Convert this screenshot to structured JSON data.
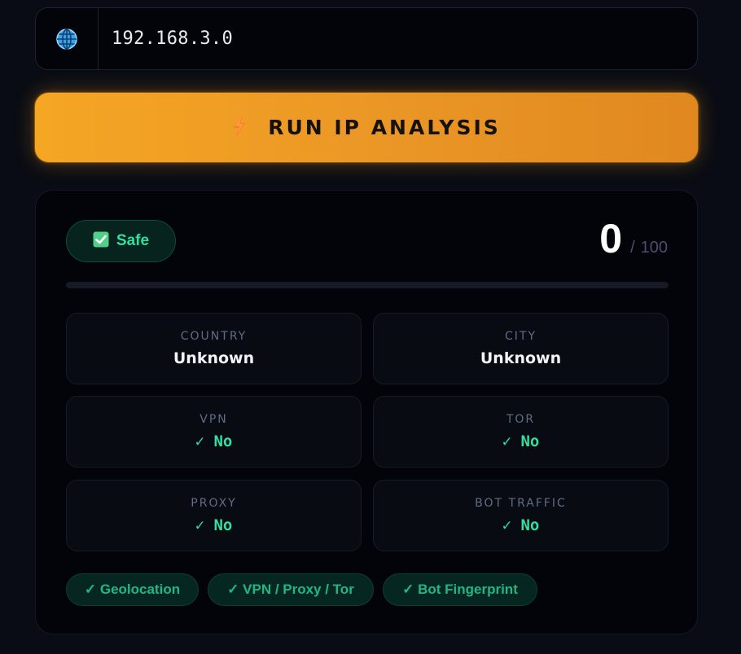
{
  "ip_input": {
    "icon": "globe-icon",
    "value": "192.168.3.0"
  },
  "run_button": {
    "icon": "lightning-icon",
    "label": "RUN IP ANALYSIS",
    "color": "#f5a623"
  },
  "result": {
    "status": {
      "icon": "check-box-icon",
      "label": "Safe",
      "color": "#2fe0a0"
    },
    "score": {
      "value": "0",
      "separator": "/",
      "max": "100",
      "fraction": 0
    },
    "fields": [
      {
        "label": "COUNTRY",
        "value": "Unknown"
      },
      {
        "label": "CITY",
        "value": "Unknown"
      },
      {
        "label": "VPN",
        "value": "✓ No"
      },
      {
        "label": "TOR",
        "value": "✓ No"
      },
      {
        "label": "PROXY",
        "value": "✓ No"
      },
      {
        "label": "BOT TRAFFIC",
        "value": "✓ No"
      }
    ],
    "checks": [
      "✓ Geolocation",
      "✓ VPN / Proxy / Tor",
      "✓ Bot Fingerprint"
    ]
  }
}
